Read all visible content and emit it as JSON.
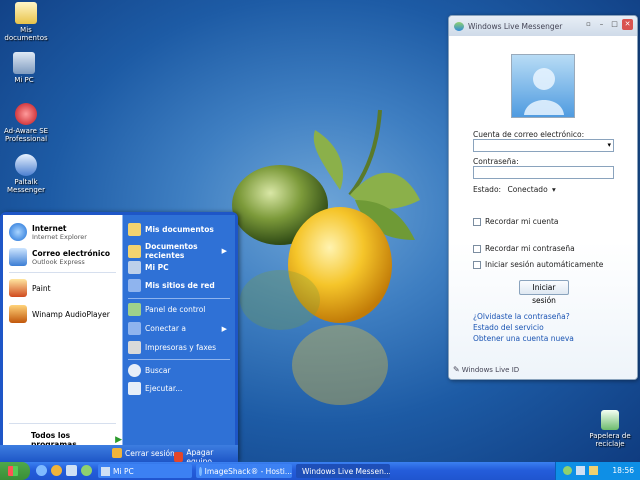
{
  "desktop": {
    "icons": [
      {
        "label": "Mis documentos"
      },
      {
        "label": "Mi PC"
      },
      {
        "label": "Ad-Aware SE Professional"
      },
      {
        "label": "Paltalk Messenger"
      },
      {
        "label": "Papelera de reciclaje"
      }
    ]
  },
  "start_menu": {
    "pinned": [
      {
        "title": "Internet",
        "subtitle": "Internet Explorer"
      },
      {
        "title": "Correo electrónico",
        "subtitle": "Outlook Express"
      }
    ],
    "recent": [
      "Paint",
      "Winamp AudioPlayer"
    ],
    "all_programs": "Todos los programas",
    "right_items": [
      "Mis documentos",
      "Documentos recientes",
      "Mi PC",
      "Mis sitios de red",
      "Panel de control",
      "Conectar a",
      "Impresoras y faxes",
      "Buscar",
      "Ejecutar..."
    ],
    "logoff": "Cerrar sesión",
    "shutdown": "Apagar equipo"
  },
  "messenger": {
    "title": "Windows Live Messenger",
    "email_label": "Cuenta de correo electrónico:",
    "email_value": "",
    "password_label": "Contraseña:",
    "status_label": "Estado:",
    "status_value": "Conectado",
    "remember_account": "Recordar mi cuenta",
    "remember_password": "Recordar mi contraseña",
    "auto_signin": "Iniciar sesión automáticamente",
    "signin_button": "Iniciar sesión",
    "links": [
      "¿Olvidaste la contraseña?",
      "Estado del servicio",
      "Obtener una cuenta nueva"
    ],
    "footer": "Windows Live ID"
  },
  "taskbar": {
    "buttons": [
      "Mi PC",
      "ImageShack® - Hosti...",
      "Windows Live Messen..."
    ],
    "clock": "18:56"
  }
}
